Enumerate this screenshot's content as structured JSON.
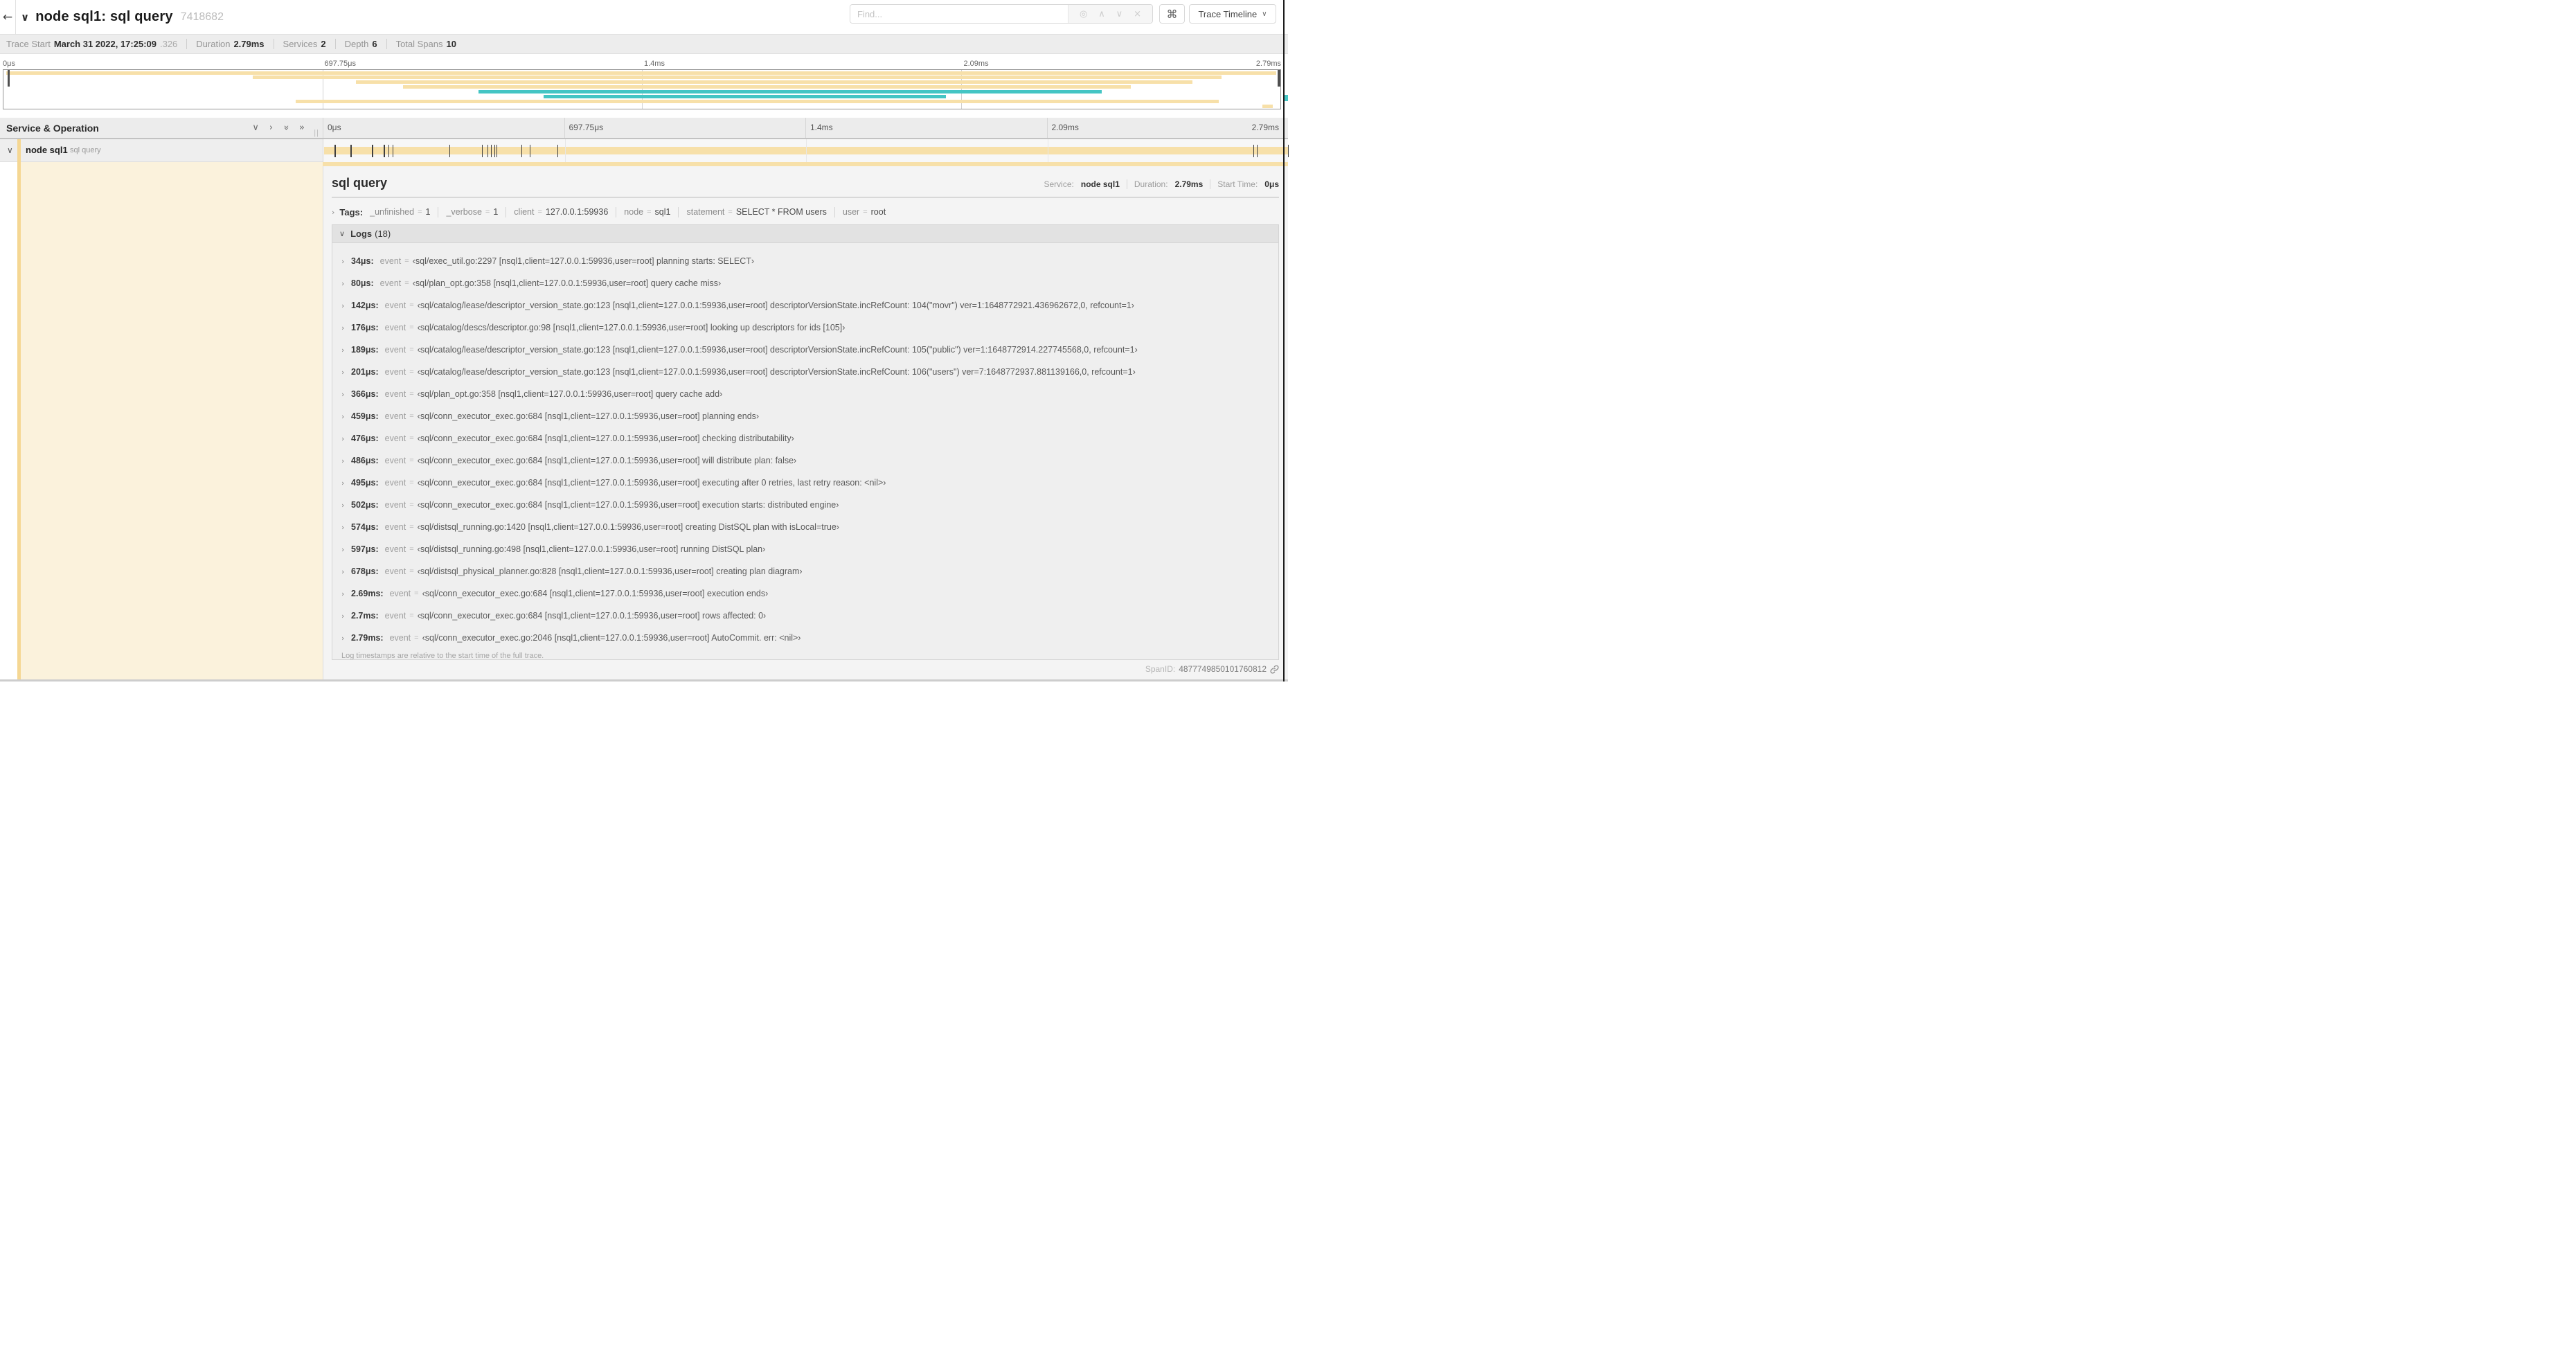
{
  "header": {
    "back_icon": "back-arrow",
    "title": "node sql1: sql query",
    "trace_id": "7418682",
    "find_placeholder": "Find...",
    "shortcut_key": "⌘",
    "view_selector": "Trace Timeline"
  },
  "summary": {
    "items": [
      {
        "label": "Trace Start",
        "value": "March 31 2022, 17:25:09",
        "suffix": ".326"
      },
      {
        "label": "Duration",
        "value": "2.79ms",
        "suffix": ""
      },
      {
        "label": "Services",
        "value": "2",
        "suffix": ""
      },
      {
        "label": "Depth",
        "value": "6",
        "suffix": ""
      },
      {
        "label": "Total Spans",
        "value": "10",
        "suffix": ""
      }
    ]
  },
  "timeline_ticks": [
    "0μs",
    "697.75μs",
    "1.4ms",
    "2.09ms",
    "2.79ms"
  ],
  "trace_duration_us": 2790,
  "colors": {
    "span_tan": "#f7e0a9",
    "stripe_tan": "#f5d793",
    "span_teal": "#44c5c4",
    "cream": "#fbf2dc"
  },
  "minimap": {
    "rows": [
      {
        "color": "tan",
        "left_pct": 0.2,
        "right_pct": 99.7
      },
      {
        "color": "tan",
        "left_pct": 19.5,
        "right_pct": 95.4
      },
      {
        "color": "tan",
        "left_pct": 27.6,
        "right_pct": 93.1
      },
      {
        "color": "tan",
        "left_pct": 31.3,
        "right_pct": 88.3
      },
      {
        "color": "teal",
        "left_pct": 37.2,
        "right_pct": 86.0
      },
      {
        "color": "teal",
        "left_pct": 42.3,
        "right_pct": 73.8
      },
      {
        "color": "tan",
        "left_pct": 22.9,
        "right_pct": 95.2
      },
      {
        "color": "tan",
        "left_pct": 98.6,
        "right_pct": 99.4
      }
    ]
  },
  "span_list": {
    "header_title": "Service & Operation",
    "row": {
      "service": "node sql1",
      "operation": "sql query"
    }
  },
  "detail": {
    "title": "sql query",
    "meta": [
      {
        "label": "Service:",
        "value": "node sql1"
      },
      {
        "label": "Duration:",
        "value": "2.79ms"
      },
      {
        "label": "Start Time:",
        "value": "0μs"
      }
    ],
    "tags_label": "Tags:",
    "tags": [
      {
        "key": "_unfinished",
        "value": "1"
      },
      {
        "key": "_verbose",
        "value": "1"
      },
      {
        "key": "client",
        "value": "127.0.0.1:59936"
      },
      {
        "key": "node",
        "value": "sql1"
      },
      {
        "key": "statement",
        "value": "SELECT * FROM users"
      },
      {
        "key": "user",
        "value": "root"
      }
    ],
    "logs_label": "Logs",
    "logs_count": "(18)",
    "logs": [
      {
        "ts": "34μs",
        "key": "event",
        "value": "‹sql/exec_util.go:2297 [nsql1,client=127.0.0.1:59936,user=root] planning starts: SELECT›"
      },
      {
        "ts": "80μs",
        "key": "event",
        "value": "‹sql/plan_opt.go:358 [nsql1,client=127.0.0.1:59936,user=root] query cache miss›"
      },
      {
        "ts": "142μs",
        "key": "event",
        "value": "‹sql/catalog/lease/descriptor_version_state.go:123 [nsql1,client=127.0.0.1:59936,user=root] descriptorVersionState.incRefCount: 104(\"movr\") ver=1:1648772921.436962672,0, refcount=1›"
      },
      {
        "ts": "176μs",
        "key": "event",
        "value": "‹sql/catalog/descs/descriptor.go:98 [nsql1,client=127.0.0.1:59936,user=root] looking up descriptors for ids [105]›"
      },
      {
        "ts": "189μs",
        "key": "event",
        "value": "‹sql/catalog/lease/descriptor_version_state.go:123 [nsql1,client=127.0.0.1:59936,user=root] descriptorVersionState.incRefCount: 105(\"public\") ver=1:1648772914.227745568,0, refcount=1›"
      },
      {
        "ts": "201μs",
        "key": "event",
        "value": "‹sql/catalog/lease/descriptor_version_state.go:123 [nsql1,client=127.0.0.1:59936,user=root] descriptorVersionState.incRefCount: 106(\"users\") ver=7:1648772937.881139166,0, refcount=1›"
      },
      {
        "ts": "366μs",
        "key": "event",
        "value": "‹sql/plan_opt.go:358 [nsql1,client=127.0.0.1:59936,user=root] query cache add›"
      },
      {
        "ts": "459μs",
        "key": "event",
        "value": "‹sql/conn_executor_exec.go:684 [nsql1,client=127.0.0.1:59936,user=root] planning ends›"
      },
      {
        "ts": "476μs",
        "key": "event",
        "value": "‹sql/conn_executor_exec.go:684 [nsql1,client=127.0.0.1:59936,user=root] checking distributability›"
      },
      {
        "ts": "486μs",
        "key": "event",
        "value": "‹sql/conn_executor_exec.go:684 [nsql1,client=127.0.0.1:59936,user=root] will distribute plan: false›"
      },
      {
        "ts": "495μs",
        "key": "event",
        "value": "‹sql/conn_executor_exec.go:684 [nsql1,client=127.0.0.1:59936,user=root] executing after 0 retries, last retry reason: <nil>›"
      },
      {
        "ts": "502μs",
        "key": "event",
        "value": "‹sql/conn_executor_exec.go:684 [nsql1,client=127.0.0.1:59936,user=root] execution starts: distributed engine›"
      },
      {
        "ts": "574μs",
        "key": "event",
        "value": "‹sql/distsql_running.go:1420 [nsql1,client=127.0.0.1:59936,user=root] creating DistSQL plan with isLocal=true›"
      },
      {
        "ts": "597μs",
        "key": "event",
        "value": "‹sql/distsql_running.go:498 [nsql1,client=127.0.0.1:59936,user=root] running DistSQL plan›"
      },
      {
        "ts": "678μs",
        "key": "event",
        "value": "‹sql/distsql_physical_planner.go:828 [nsql1,client=127.0.0.1:59936,user=root] creating plan diagram›"
      },
      {
        "ts": "2.69ms",
        "key": "event",
        "value": "‹sql/conn_executor_exec.go:684 [nsql1,client=127.0.0.1:59936,user=root] execution ends›"
      },
      {
        "ts": "2.7ms",
        "key": "event",
        "value": "‹sql/conn_executor_exec.go:684 [nsql1,client=127.0.0.1:59936,user=root] rows affected: 0›"
      },
      {
        "ts": "2.79ms",
        "key": "event",
        "value": "‹sql/conn_executor_exec.go:2046 [nsql1,client=127.0.0.1:59936,user=root] AutoCommit. err: <nil>›"
      }
    ],
    "logs_footer": "Log timestamps are relative to the start time of the full trace.",
    "spanid_label": "SpanID:",
    "spanid": "4877749850101760812"
  }
}
